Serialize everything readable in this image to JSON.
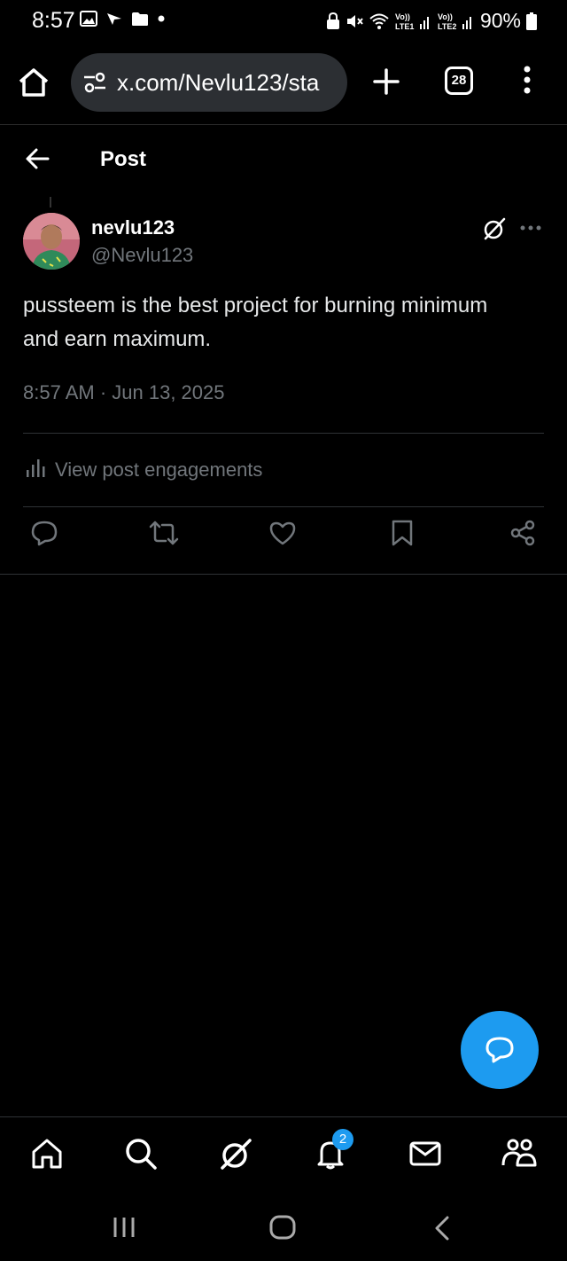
{
  "status_bar": {
    "time": "8:57",
    "battery": "90%",
    "left_icons": [
      "gallery-icon",
      "arrow-plane-icon",
      "folder-icon",
      "dot-icon"
    ],
    "right_icons": [
      "lock-icon",
      "mute-icon",
      "wifi-icon",
      "signal-lte1-icon",
      "signal-lte2-icon",
      "battery-icon"
    ]
  },
  "browser": {
    "url": "x.com/Nevlu123/sta",
    "tab_count": "28"
  },
  "header": {
    "title": "Post"
  },
  "post": {
    "author_name": "nevlu123",
    "author_handle": "@Nevlu123",
    "text": "pussteem is the best project for burning minimum and earn maximum.",
    "timestamp": "8:57 AM · Jun 13, 2025",
    "engagements_label": "View post engagements"
  },
  "actions": [
    "reply-icon",
    "repost-icon",
    "like-icon",
    "bookmark-icon",
    "share-icon"
  ],
  "bottom_nav": {
    "items": [
      "home-icon",
      "search-icon",
      "grok-icon",
      "notifications-icon",
      "messages-icon",
      "communities-icon"
    ],
    "notification_count": "2"
  },
  "colors": {
    "accent": "#1d9bf0",
    "muted": "#71767b",
    "background": "#000000"
  }
}
